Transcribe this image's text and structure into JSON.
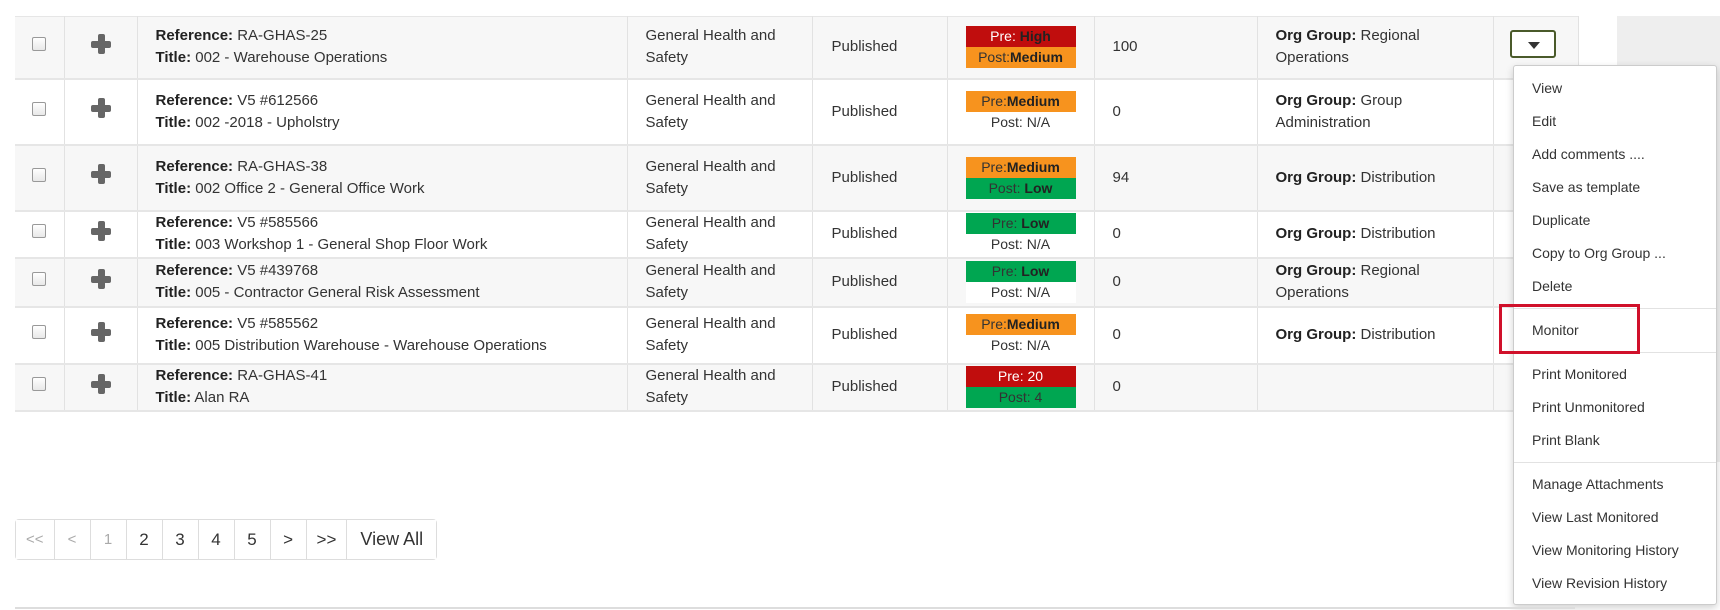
{
  "rows": [
    {
      "ref_label": "Reference:",
      "ref": "RA-GHAS-25",
      "title_label": "Title:",
      "title": "002 - Warehouse Operations",
      "category": "General Health and Safety",
      "status": "Published",
      "risk": [
        {
          "text": "Pre: ",
          "bold": "High",
          "level": "high"
        },
        {
          "text": "Post:",
          "bold": "Medium",
          "level": "med"
        }
      ],
      "score": "100",
      "org_label": "Org Group:",
      "org": "Regional Operations",
      "has_action": true
    },
    {
      "ref_label": "Reference:",
      "ref": "V5 #612566",
      "title_label": "Title:",
      "title": "002 -2018 - Upholstry",
      "category": "General Health and Safety",
      "status": "Published",
      "risk": [
        {
          "text": "Pre:",
          "bold": "Medium",
          "level": "med"
        },
        {
          "text": "Post: N/A",
          "bold": "",
          "level": "na"
        }
      ],
      "score": "0",
      "org_label": "Org Group:",
      "org": "Group Administration",
      "has_action": false
    },
    {
      "ref_label": "Reference:",
      "ref": "RA-GHAS-38",
      "title_label": "Title:",
      "title": "002 Office 2 - General Office Work",
      "category": "General Health and Safety",
      "status": "Published",
      "risk": [
        {
          "text": "Pre:",
          "bold": "Medium",
          "level": "med"
        },
        {
          "text": "Post: ",
          "bold": "Low",
          "level": "low"
        }
      ],
      "score": "94",
      "org_label": "Org Group:",
      "org": "Distribution",
      "has_action": false
    },
    {
      "ref_label": "Reference:",
      "ref": "V5 #585566",
      "title_label": "Title:",
      "title": "003 Workshop 1 - General Shop Floor Work",
      "category": "General Health and Safety",
      "status": "Published",
      "risk": [
        {
          "text": "Pre: ",
          "bold": "Low",
          "level": "low"
        },
        {
          "text": "Post: N/A",
          "bold": "",
          "level": "na"
        }
      ],
      "score": "0",
      "org_label": "Org Group:",
      "org": "Distribution",
      "has_action": false
    },
    {
      "ref_label": "Reference:",
      "ref": "V5 #439768",
      "title_label": "Title:",
      "title": "005 - Contractor General Risk Assessment",
      "category": "General Health and Safety",
      "status": "Published",
      "risk": [
        {
          "text": "Pre: ",
          "bold": "Low",
          "level": "low"
        },
        {
          "text": "Post: N/A",
          "bold": "",
          "level": "na"
        }
      ],
      "score": "0",
      "org_label": "Org Group:",
      "org": "Regional Operations",
      "has_action": false
    },
    {
      "ref_label": "Reference:",
      "ref": "V5 #585562",
      "title_label": "Title:",
      "title": "005 Distribution Warehouse - Warehouse Operations",
      "category": "General Health and Safety",
      "status": "Published",
      "risk": [
        {
          "text": "Pre:",
          "bold": "Medium",
          "level": "med"
        },
        {
          "text": "Post: N/A",
          "bold": "",
          "level": "na"
        }
      ],
      "score": "0",
      "org_label": "Org Group:",
      "org": "Distribution",
      "has_action": false
    },
    {
      "ref_label": "Reference:",
      "ref": "RA-GHAS-41",
      "title_label": "Title:",
      "title": "Alan RA",
      "category": "General Health and Safety",
      "status": "Published",
      "risk": [
        {
          "text": "Pre: 20",
          "bold": "",
          "level": "high"
        },
        {
          "text": "Post: 4",
          "bold": "",
          "level": "low"
        }
      ],
      "score": "0",
      "org_label": "",
      "org": "",
      "has_action": false
    }
  ],
  "menu": {
    "groups": [
      [
        "View",
        "Edit",
        "Add comments ....",
        "Save as template",
        "Duplicate",
        "Copy to Org Group ...",
        "Delete"
      ],
      [
        "Monitor"
      ],
      [
        "Print Monitored",
        "Print Unmonitored",
        "Print Blank"
      ],
      [
        "Manage Attachments",
        "View Last Monitored",
        "View Monitoring History",
        "View Revision History"
      ]
    ],
    "highlighted": "Monitor"
  },
  "pagination": {
    "items": [
      "<<",
      "<",
      "1",
      "2",
      "3",
      "4",
      "5",
      ">",
      ">>",
      "View All"
    ],
    "disabled": [
      "<<",
      "<",
      "1"
    ]
  },
  "colors": {
    "high": "#c00d0d",
    "medium": "#f7931e",
    "low": "#00a651",
    "highlight_box": "#d0102a"
  }
}
